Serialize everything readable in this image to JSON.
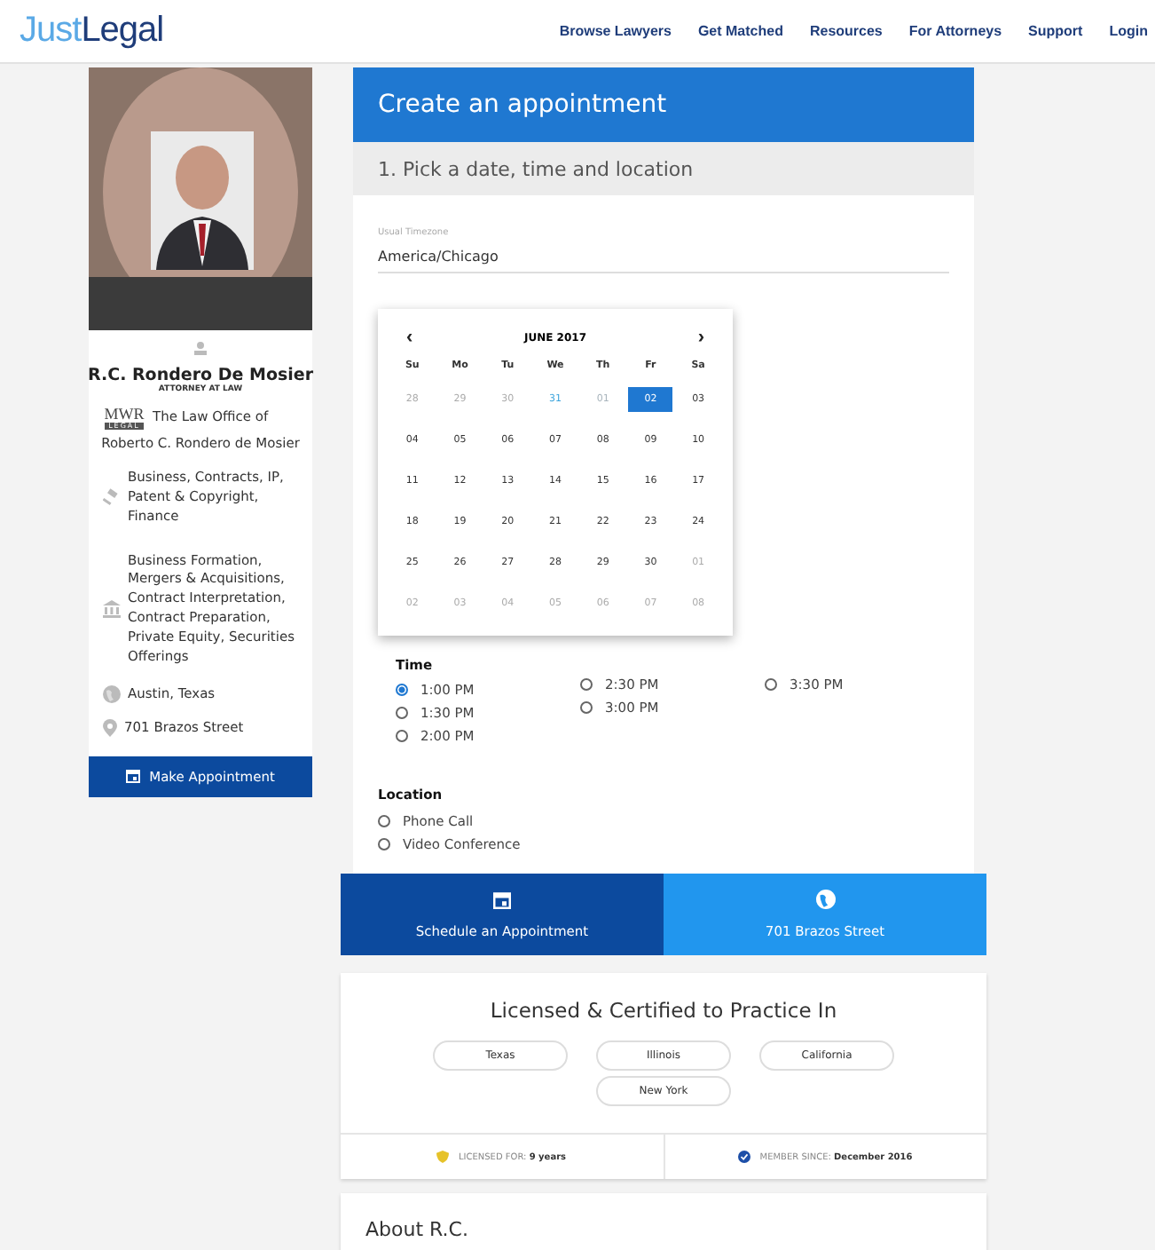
{
  "header": {
    "logo": {
      "light": "Just",
      "dark": "Legal"
    },
    "nav": [
      "Browse Lawyers",
      "Get Matched",
      "Resources",
      "For Attorneys",
      "Support",
      "Login"
    ]
  },
  "profile": {
    "name": "R.C. Rondero De Mosier",
    "role": "ATTORNEY AT LAW",
    "firm_logo": {
      "top": "MWR",
      "bottom": "LEGAL"
    },
    "firm_line_1": "The Law Office of",
    "firm_line_2": "Roberto C. Rondero de Mosier",
    "practice_areas": "Business, Contracts, IP, Patent & Copyright, Finance",
    "specialties": "Business Formation, Mergers & Acquisitions, Contract Interpretation, Contract Preparation, Private Equity, Securities Offerings",
    "city": "Austin, Texas",
    "address": "701 Brazos Street",
    "button": "Make Appointment"
  },
  "appointment": {
    "title": "Create an appointment",
    "step": "1. Pick a date, time and location",
    "timezone": {
      "label": "Usual Timezone",
      "value": "America/Chicago"
    },
    "calendar": {
      "month": "JUNE 2017",
      "prev": "‹",
      "next": "›",
      "weekdays": [
        "Su",
        "Mo",
        "Tu",
        "We",
        "Th",
        "Fr",
        "Sa"
      ],
      "weeks": [
        [
          {
            "day": "28",
            "kind": "muted",
            "selected": false
          },
          {
            "day": "29",
            "kind": "muted",
            "selected": false
          },
          {
            "day": "30",
            "kind": "muted",
            "selected": false
          },
          {
            "day": "31",
            "kind": "today",
            "selected": false
          },
          {
            "day": "01",
            "kind": "disabled",
            "selected": false
          },
          {
            "day": "02",
            "kind": "normal",
            "selected": true
          },
          {
            "day": "03",
            "kind": "normal",
            "selected": false
          }
        ],
        [
          {
            "day": "04",
            "kind": "normal",
            "selected": false
          },
          {
            "day": "05",
            "kind": "normal",
            "selected": false
          },
          {
            "day": "06",
            "kind": "normal",
            "selected": false
          },
          {
            "day": "07",
            "kind": "normal",
            "selected": false
          },
          {
            "day": "08",
            "kind": "normal",
            "selected": false
          },
          {
            "day": "09",
            "kind": "normal",
            "selected": false
          },
          {
            "day": "10",
            "kind": "normal",
            "selected": false
          }
        ],
        [
          {
            "day": "11",
            "kind": "normal",
            "selected": false
          },
          {
            "day": "12",
            "kind": "normal",
            "selected": false
          },
          {
            "day": "13",
            "kind": "normal",
            "selected": false
          },
          {
            "day": "14",
            "kind": "normal",
            "selected": false
          },
          {
            "day": "15",
            "kind": "normal",
            "selected": false
          },
          {
            "day": "16",
            "kind": "normal",
            "selected": false
          },
          {
            "day": "17",
            "kind": "normal",
            "selected": false
          }
        ],
        [
          {
            "day": "18",
            "kind": "normal",
            "selected": false
          },
          {
            "day": "19",
            "kind": "normal",
            "selected": false
          },
          {
            "day": "20",
            "kind": "normal",
            "selected": false
          },
          {
            "day": "21",
            "kind": "normal",
            "selected": false
          },
          {
            "day": "22",
            "kind": "normal",
            "selected": false
          },
          {
            "day": "23",
            "kind": "normal",
            "selected": false
          },
          {
            "day": "24",
            "kind": "normal",
            "selected": false
          }
        ],
        [
          {
            "day": "25",
            "kind": "normal",
            "selected": false
          },
          {
            "day": "26",
            "kind": "normal",
            "selected": false
          },
          {
            "day": "27",
            "kind": "normal",
            "selected": false
          },
          {
            "day": "28",
            "kind": "normal",
            "selected": false
          },
          {
            "day": "29",
            "kind": "normal",
            "selected": false
          },
          {
            "day": "30",
            "kind": "normal",
            "selected": false
          },
          {
            "day": "01",
            "kind": "muted",
            "selected": false
          }
        ],
        [
          {
            "day": "02",
            "kind": "muted",
            "selected": false
          },
          {
            "day": "03",
            "kind": "muted",
            "selected": false
          },
          {
            "day": "04",
            "kind": "muted",
            "selected": false
          },
          {
            "day": "05",
            "kind": "muted",
            "selected": false
          },
          {
            "day": "06",
            "kind": "muted",
            "selected": false
          },
          {
            "day": "07",
            "kind": "muted",
            "selected": false
          },
          {
            "day": "08",
            "kind": "muted",
            "selected": false
          }
        ]
      ]
    },
    "time": {
      "label": "Time",
      "columns": [
        [
          {
            "label": "1:00 PM",
            "selected": true
          },
          {
            "label": "1:30 PM",
            "selected": false
          },
          {
            "label": "2:00 PM",
            "selected": false
          }
        ],
        [
          {
            "label": "2:30 PM",
            "selected": false
          },
          {
            "label": "3:00 PM",
            "selected": false
          }
        ],
        [
          {
            "label": "3:30 PM",
            "selected": false
          }
        ]
      ]
    },
    "location": {
      "label": "Location",
      "options": [
        {
          "label": "Phone Call",
          "selected": false
        },
        {
          "label": "Video Conference",
          "selected": false
        }
      ]
    },
    "schedule_button": "Schedule an Appointment",
    "address_button": "701 Brazos Street"
  },
  "licenses": {
    "title": "Licensed & Certified to Practice In",
    "states": [
      "Texas",
      "Illinois",
      "California",
      "New York"
    ],
    "licensed_for": {
      "label": "LICENSED FOR:",
      "value": "9 years"
    },
    "member_since": {
      "label": "MEMBER SINCE:",
      "value": "December 2016"
    }
  },
  "about": {
    "title": "About R.C."
  }
}
